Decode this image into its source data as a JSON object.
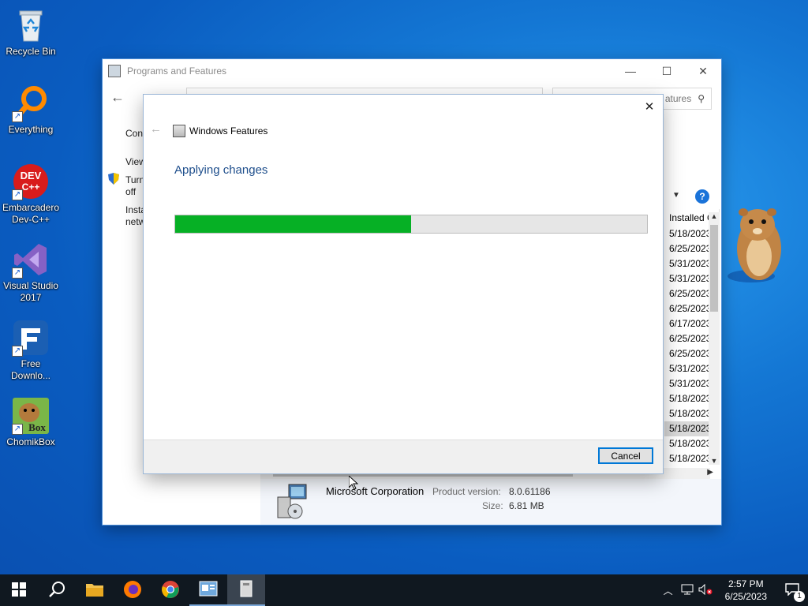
{
  "desktop": {
    "icons": [
      {
        "label": "Recycle Bin",
        "icon": "recycle-bin-icon"
      },
      {
        "label": "Everything",
        "icon": "everything-search-icon"
      },
      {
        "label": "Embarcadero Dev-C++",
        "icon": "devcpp-icon",
        "badge": "DEV C++"
      },
      {
        "label": "Visual Studio 2017",
        "icon": "visual-studio-icon"
      },
      {
        "label": "Free Downlo...",
        "icon": "free-download-manager-icon"
      },
      {
        "label": "ChomikBox",
        "icon": "chomikbox-icon",
        "badge": "Box"
      }
    ]
  },
  "programs_window": {
    "title": "Programs and Features",
    "search_placeholder": "atures",
    "sidebar": {
      "item1": "Con",
      "item2": "View",
      "item3a": "Turn",
      "item3b": "off",
      "item4a": "Insta",
      "item4b": "netw"
    },
    "column_installed": "Installed O",
    "installed_dates": [
      "5/18/2023",
      "6/25/2023",
      "5/31/2023",
      "5/31/2023",
      "6/25/2023",
      "6/25/2023",
      "6/17/2023",
      "6/25/2023",
      "6/25/2023",
      "5/31/2023",
      "5/31/2023",
      "5/18/2023",
      "5/18/2023",
      "5/18/2023",
      "5/18/2023",
      "5/18/2023"
    ],
    "selected_row_index": 13,
    "details": {
      "publisher": "Microsoft Corporation",
      "product_version_label": "Product version:",
      "product_version": "8.0.61186",
      "size_label": "Size:",
      "size": "6.81 MB"
    }
  },
  "features_dialog": {
    "title": "Windows Features",
    "heading": "Applying changes",
    "progress_fraction": 0.5,
    "cancel_label": "Cancel"
  },
  "taskbar": {
    "time": "2:57 PM",
    "date": "6/25/2023",
    "notification_count": "1"
  },
  "colors": {
    "accent": "#0078d7",
    "progress": "#06b025",
    "heading": "#1e4e8c"
  }
}
